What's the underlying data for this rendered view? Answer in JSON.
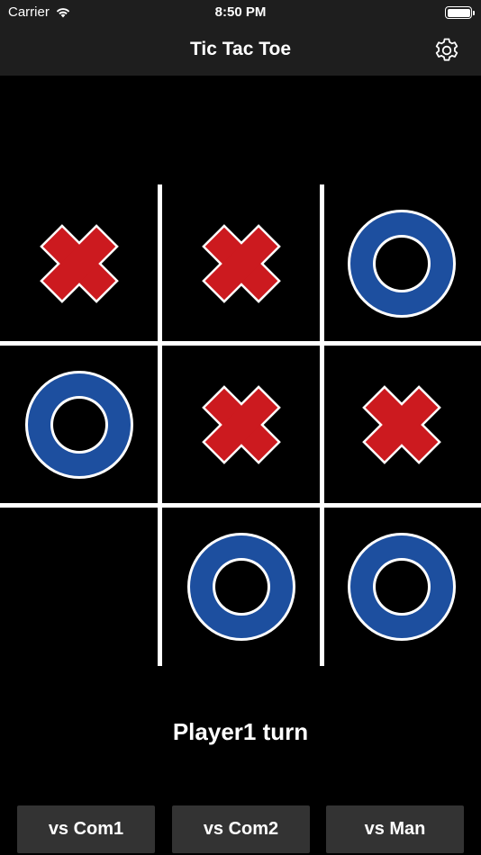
{
  "status_bar": {
    "carrier": "Carrier",
    "time": "8:50 PM"
  },
  "nav": {
    "title": "Tic Tac Toe",
    "settings_icon": "gear-icon"
  },
  "board": {
    "cells": [
      "X",
      "X",
      "O",
      "O",
      "X",
      "X",
      "",
      "O",
      "O"
    ],
    "colors": {
      "x": "#cc1a1f",
      "o": "#1d4f9f",
      "outline": "#ffffff",
      "grid": "#ffffff"
    }
  },
  "status": {
    "turn_text": "Player1 turn"
  },
  "modes": {
    "com1": "vs Com1",
    "com2": "vs Com2",
    "man": "vs Man"
  }
}
